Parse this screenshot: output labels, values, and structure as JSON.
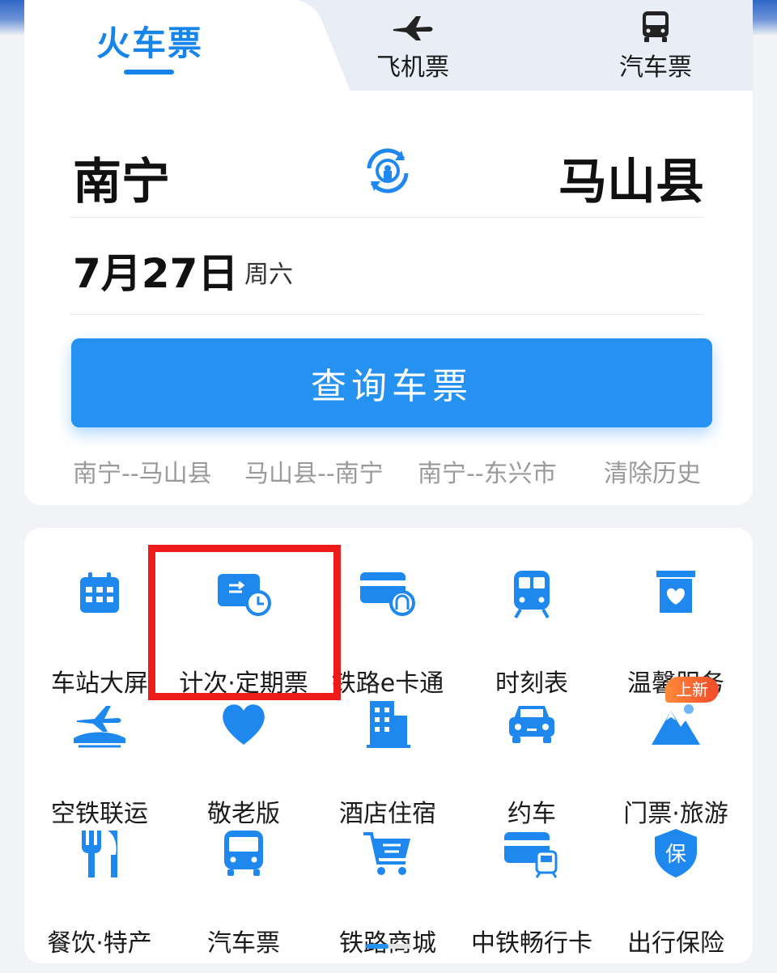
{
  "tabs": {
    "train": "火车票",
    "flight": "飞机票",
    "bus": "汽车票"
  },
  "route": {
    "from": "南宁",
    "to": "马山县",
    "swap_icon": "swap-circle-icon"
  },
  "date": {
    "day": "7月27日",
    "weekday": "周六"
  },
  "search_button": "查询车票",
  "history": {
    "items": [
      "南宁--马山县",
      "马山县--南宁",
      "南宁--东兴市"
    ],
    "clear": "清除历史"
  },
  "services": [
    {
      "label": "车站大屏",
      "icon": "calendar-icon"
    },
    {
      "label": "计次·定期票",
      "icon": "ticket-clock-icon"
    },
    {
      "label": "铁路e卡通",
      "icon": "rail-card-icon"
    },
    {
      "label": "时刻表",
      "icon": "train-front-icon"
    },
    {
      "label": "温馨服务",
      "icon": "heart-bag-icon"
    },
    {
      "label": "空铁联运",
      "icon": "plane-train-icon"
    },
    {
      "label": "敬老版",
      "icon": "heart-icon"
    },
    {
      "label": "酒店住宿",
      "icon": "hotel-icon"
    },
    {
      "label": "约车",
      "icon": "car-icon"
    },
    {
      "label": "门票·旅游",
      "icon": "mountain-icon"
    },
    {
      "label": "餐饮·特产",
      "icon": "cutlery-icon"
    },
    {
      "label": "汽车票",
      "icon": "bus-icon"
    },
    {
      "label": "铁路商城",
      "icon": "cart-icon"
    },
    {
      "label": "中铁畅行卡",
      "icon": "card-train-icon"
    },
    {
      "label": "出行保险",
      "icon": "shield-insurance-icon"
    }
  ],
  "badge_new": "上新",
  "colors": {
    "accent": "#2591f0",
    "highlight": "#ee1b1b",
    "badge": "#f24a2a"
  }
}
